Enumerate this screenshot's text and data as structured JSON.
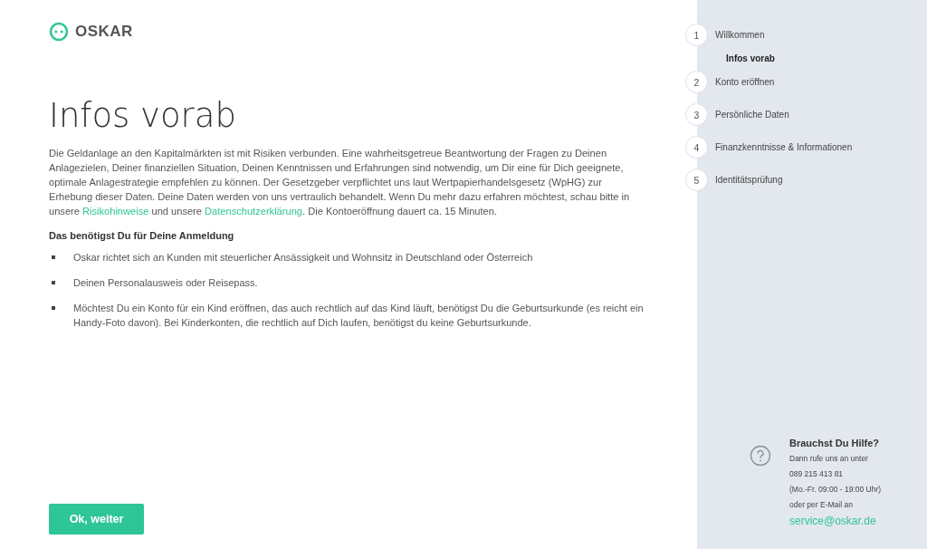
{
  "logo": {
    "text": "OSKAR"
  },
  "title": "Infos vorab",
  "intro": [
    {
      "kind": "text",
      "text": "Die Geldanlage an den Kapitalmärkten ist mit Risiken verbunden. Eine wahrheitsgetreue Beantwortung der Fragen zu Deinen Anlagezielen, Deiner finanziellen Situation, Deinen Kenntnissen und Erfahrungen sind notwendig, um Dir eine für Dich geeignete, optimale Anlagestrategie empfehlen zu können. Der Gesetzgeber verpflichtet uns laut Wertpapierhandelsgesetz (WpHG) zur Erhebung dieser Daten. Deine Daten werden von uns vertraulich behandelt. Wenn Du mehr dazu erfahren möchtest, schau bitte in unsere "
    },
    {
      "kind": "link",
      "text": "Risikohinweise"
    },
    {
      "kind": "text",
      "text": " und unsere "
    },
    {
      "kind": "link",
      "text": "Datenschutzerklärung"
    },
    {
      "kind": "text",
      "text": ". Die Kontoeröffnung dauert ca. 15 Minuten."
    }
  ],
  "requirements": {
    "heading": "Das benötigst Du für Deine Anmeldung",
    "items": [
      "Oskar richtet sich an Kunden mit steuerlicher Ansässigkeit und Wohnsitz in Deutschland oder Österreich",
      "Deinen Personalausweis oder Reisepass.",
      "Möchtest Du ein Konto für ein Kind eröffnen, das auch rechtlich auf das Kind läuft, benötigst Du die Geburtsurkunde (es reicht ein Handy-Foto davon). Bei Kinderkonten, die rechtlich auf Dich laufen, benötigst du keine Geburtsurkunde."
    ]
  },
  "button": "Ok, weiter",
  "steps": [
    {
      "number": "1",
      "label": "Willkommen",
      "children": [
        {
          "label": "Infos vorab",
          "selected": true
        }
      ]
    },
    {
      "number": "2",
      "label": "Konto eröffnen"
    },
    {
      "number": "3",
      "label": "Persönliche Daten"
    },
    {
      "number": "4",
      "label": "Finanzkenntnisse & Informationen"
    },
    {
      "number": "5",
      "label": "Identitätsprüfung"
    }
  ],
  "help": {
    "title": "Brauchst Du Hilfe?",
    "lines": [
      "Dann rufe uns an unter",
      "089 215 413 81",
      "(Mo.-Fr. 09:00 - 19:00 Uhr)",
      "oder per E-Mail an"
    ],
    "email": "service@oskar.de"
  }
}
